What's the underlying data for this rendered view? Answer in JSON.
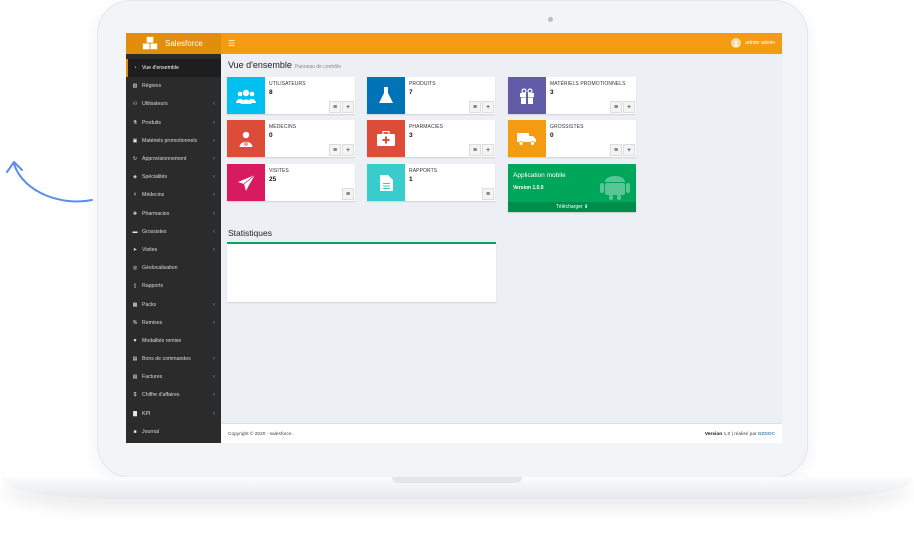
{
  "colors": {
    "header": "#f39c12",
    "brand_bg": "#e08e0b",
    "sidebar": "#2b2b2b",
    "aqua": "#00c0ef",
    "blue": "#0073b7",
    "purple": "#605ca8",
    "red": "#dd4b39",
    "orange": "#f39c12",
    "maroon": "#d81b60",
    "teal": "#39cccc",
    "green": "#00a65a"
  },
  "brand": {
    "name": "Salesforce"
  },
  "header": {
    "menu_icon": "hamburger-icon",
    "user_name": "admin admin"
  },
  "sidebar": {
    "items": [
      {
        "label": "Vue d'ensemble",
        "icon": "dashboard-icon",
        "active": true,
        "caret": false
      },
      {
        "label": "Régions",
        "icon": "map-icon",
        "caret": false
      },
      {
        "label": "Utilisateurs",
        "icon": "users-icon",
        "caret": true
      },
      {
        "label": "Produits",
        "icon": "flask-icon",
        "caret": true
      },
      {
        "label": "Matériels promotionnels",
        "icon": "gift-icon",
        "caret": true
      },
      {
        "label": "Approvisionnement",
        "icon": "refresh-icon",
        "caret": true
      },
      {
        "label": "Spécialités",
        "icon": "tags-icon",
        "caret": true
      },
      {
        "label": "Médecins",
        "icon": "doctor-icon",
        "caret": true
      },
      {
        "label": "Pharmacies",
        "icon": "medkit-icon",
        "caret": true
      },
      {
        "label": "Grossistes",
        "icon": "truck-icon",
        "caret": true
      },
      {
        "label": "Visites",
        "icon": "send-icon",
        "caret": true
      },
      {
        "label": "Géolocalisation",
        "icon": "globe-icon",
        "caret": false
      },
      {
        "label": "Rapports",
        "icon": "file-icon",
        "caret": false
      },
      {
        "label": "Packs",
        "icon": "cubes-icon",
        "caret": true
      },
      {
        "label": "Remises",
        "icon": "percent-icon",
        "caret": true
      },
      {
        "label": "Modalités remise",
        "icon": "bookmark-icon",
        "caret": false
      },
      {
        "label": "Bons de commandes",
        "icon": "cart-icon",
        "caret": true
      },
      {
        "label": "Factures",
        "icon": "cart-icon",
        "caret": true
      },
      {
        "label": "Chiffre d'affaires",
        "icon": "dollar-icon",
        "caret": true
      },
      {
        "label": "KPI",
        "icon": "bar-chart-icon",
        "caret": true
      },
      {
        "label": "Journal",
        "icon": "book-icon",
        "caret": false
      }
    ]
  },
  "page": {
    "title": "Vue d'ensemble",
    "subtitle": "Panneau de contrôle"
  },
  "boxes": {
    "utilisateurs": {
      "label": "UTILISATEURS",
      "value": "8"
    },
    "produits": {
      "label": "PRODUITS",
      "value": "7"
    },
    "materiels": {
      "label": "MATÉRIELS PROMOTIONNELS",
      "value": "3"
    },
    "medecins": {
      "label": "MÉDECINS",
      "value": "0"
    },
    "pharmacies": {
      "label": "PHARMACIES",
      "value": "3"
    },
    "grossistes": {
      "label": "GROSSISTES",
      "value": "0"
    },
    "visites": {
      "label": "VISITES",
      "value": "25"
    },
    "rapports": {
      "label": "RAPPORTS",
      "value": "1"
    }
  },
  "box_buttons": {
    "list_icon": "list-icon",
    "add_icon": "plus-icon"
  },
  "mobile": {
    "title": "Application mobile",
    "version": "Version 1.0.0",
    "download": "Télécharger"
  },
  "statistics": {
    "title": "Statistiques"
  },
  "footer": {
    "copyright": "Copyright © 2020 - salesforce .",
    "version_label": "Version",
    "version_value": "1.0",
    "made_by": "| réalisé par",
    "made_by_brand": "DZDOC"
  }
}
